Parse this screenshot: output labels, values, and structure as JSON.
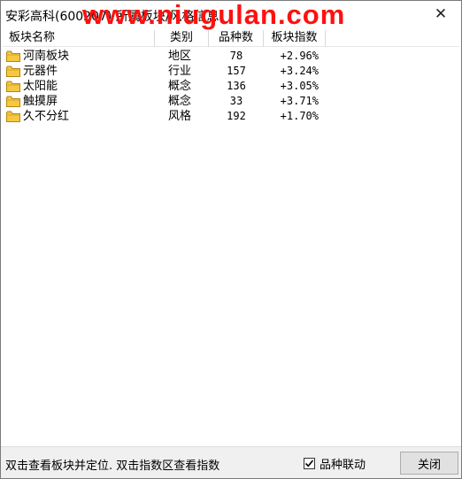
{
  "window": {
    "title": "安彩高科(600207) 所属板块/风格信息",
    "watermark": "www.niugulan.com",
    "close_glyph": "✕"
  },
  "table": {
    "columns": [
      "板块名称",
      "类别",
      "品种数",
      "板块指数"
    ],
    "rows": [
      {
        "name": "河南板块",
        "type": "地区",
        "count": "78",
        "index": "+2.96%"
      },
      {
        "name": "元器件",
        "type": "行业",
        "count": "157",
        "index": "+3.24%"
      },
      {
        "name": "太阳能",
        "type": "概念",
        "count": "136",
        "index": "+3.05%"
      },
      {
        "name": "触摸屏",
        "type": "概念",
        "count": "33",
        "index": "+3.71%"
      },
      {
        "name": "久不分红",
        "type": "风格",
        "count": "192",
        "index": "+1.70%"
      }
    ]
  },
  "footer": {
    "hint": "双击查看板块并定位. 双击指数区查看指数",
    "checkbox_label": "品种联动",
    "checkbox_checked": true,
    "close_label": "关闭"
  },
  "colors": {
    "watermark": "#ff1010",
    "folder": "#f5c842"
  },
  "icons": {
    "row_icon": "folder-icon",
    "check_icon": "checkmark-icon"
  }
}
